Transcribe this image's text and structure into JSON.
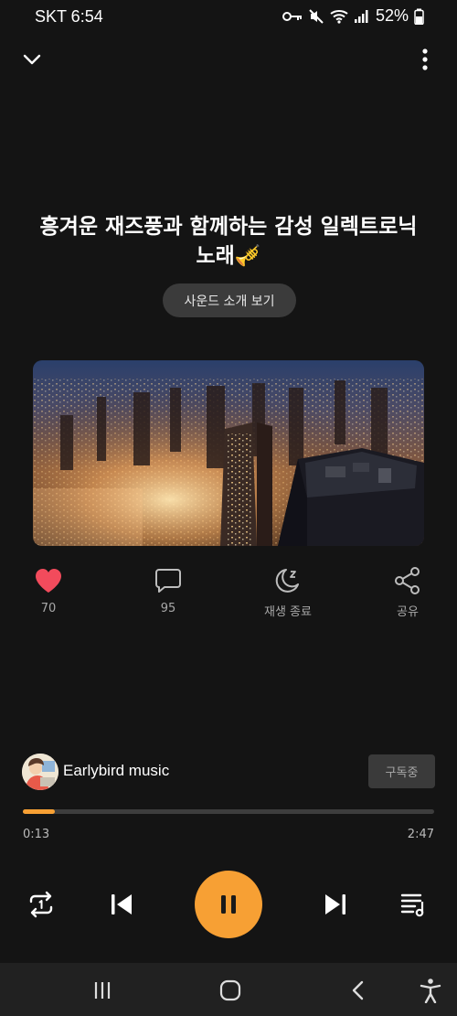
{
  "status_bar": {
    "carrier": "SKT 6:54",
    "battery": "52%"
  },
  "track": {
    "title": "흥겨운 재즈풍과 함께하는 감성 일렉트로닉 노래🎺",
    "sound_intro_label": "사운드 소개 보기"
  },
  "actions": {
    "like_count": "70",
    "comment_count": "95",
    "sleep_label": "재생 종료",
    "share_label": "공유"
  },
  "channel": {
    "name": "Earlybird music",
    "subscribe_label": "구독중"
  },
  "player": {
    "current_time": "0:13",
    "total_time": "2:47",
    "progress": 0.078
  },
  "colors": {
    "accent": "#f7a034",
    "like": "#f24b5c",
    "background": "#141414"
  },
  "icons": {
    "collapse": "chevron-down-icon",
    "more": "more-vertical-icon",
    "like": "heart-icon",
    "comment": "comment-icon",
    "sleep": "sleep-timer-icon",
    "share": "share-icon",
    "repeat": "repeat-one-icon",
    "prev": "skip-previous-icon",
    "play": "pause-icon",
    "next": "skip-next-icon",
    "queue": "playlist-icon"
  }
}
